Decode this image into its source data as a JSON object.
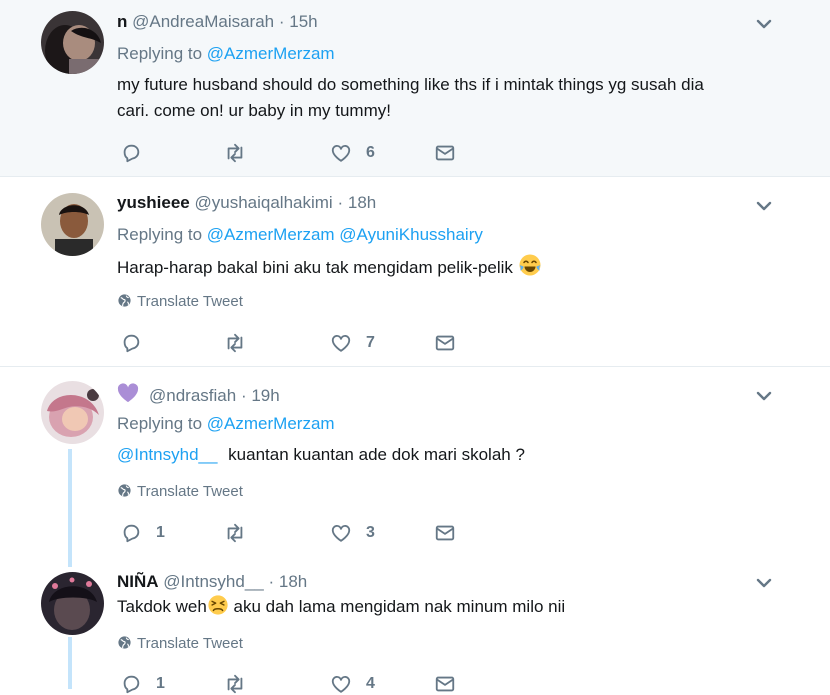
{
  "tweets": [
    {
      "name": "n",
      "handle": "@AndreaMaisarah",
      "time": "15h",
      "replying_label": "Replying to",
      "replying_to": [
        "@AzmerMerzam"
      ],
      "text_lines": [
        "my future husband should do something like ths if i mintak things yg susah dia",
        "cari. come on! ur baby in my tummy!"
      ],
      "likes": "6"
    },
    {
      "name": "yushieee",
      "handle": "@yushaiqalhakimi",
      "time": "18h",
      "replying_label": "Replying to",
      "replying_to": [
        "@AzmerMerzam",
        "@AyuniKhusshairy"
      ],
      "text": "Harap-harap bakal bini aku tak mengidam pelik-pelik",
      "emoji": "tears-of-joy-emoji",
      "translate": "Translate Tweet",
      "likes": "7"
    },
    {
      "handle": "@ndrasfiah",
      "time": "19h",
      "name_icon": "purple-heart-emoji",
      "replying_label": "Replying to",
      "replying_to": [
        "@AzmerMerzam"
      ],
      "mention": "@Intnsyhd__",
      "text": "kuantan kuantan ade dok mari skolah ?",
      "translate": "Translate Tweet",
      "replies": "1",
      "likes": "3"
    },
    {
      "name": "NIÑA",
      "handle": "@Intnsyhd__",
      "time": "18h",
      "text_before": "Takdok weh",
      "emoji": "persevering-face-emoji",
      "text_after": " aku dah lama mengidam nak minum milo nii",
      "translate": "Translate Tweet",
      "replies": "1",
      "likes": "4"
    }
  ],
  "separator": "·",
  "colors": {
    "link": "#1da1f2",
    "muted": "#657786",
    "highlight_bg": "#f5f8fa",
    "thread_line": "#c4e4fb",
    "heart_emoji": "#aa8ed6"
  }
}
